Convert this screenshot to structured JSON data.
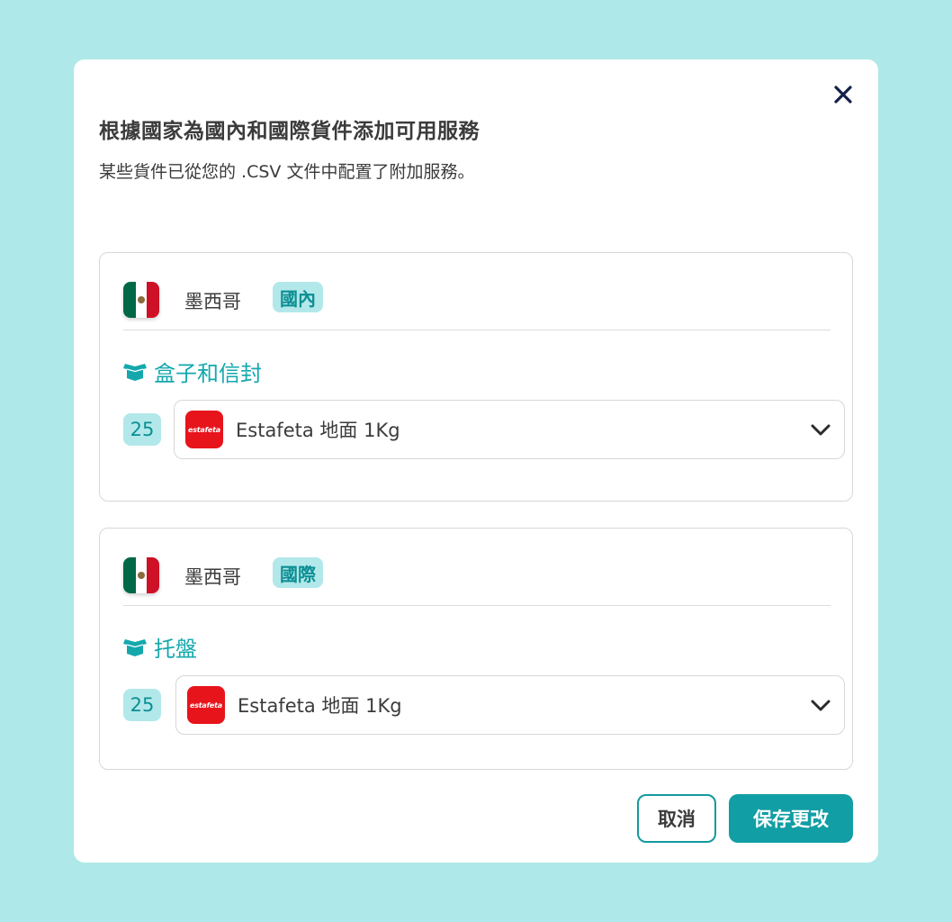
{
  "dialog": {
    "title": "根據國家為國內和國際貨件添加可用服務",
    "subtitle": "某些貨件已從您的 .CSV 文件中配置了附加服務。"
  },
  "sections": [
    {
      "country": "墨西哥",
      "scope": "國內",
      "category": "盒子和信封",
      "quantity": "25",
      "carrier_logo_text": "estafeta",
      "service": "Estafeta 地面 1Kg"
    },
    {
      "country": "墨西哥",
      "scope": "國際",
      "category": "托盤",
      "quantity": "25",
      "carrier_logo_text": "estafeta",
      "service": "Estafeta 地面 1Kg"
    }
  ],
  "actions": {
    "cancel": "取消",
    "save": "保存更改"
  },
  "icons": {
    "close": "close-icon",
    "box": "box-icon",
    "chevron": "chevron-down-icon",
    "flag": "mexico-flag-icon"
  },
  "colors": {
    "background": "#aee8e8",
    "accent": "#119ea4",
    "badge_bg": "#b3e8ea",
    "carrier_red": "#e8141c"
  }
}
